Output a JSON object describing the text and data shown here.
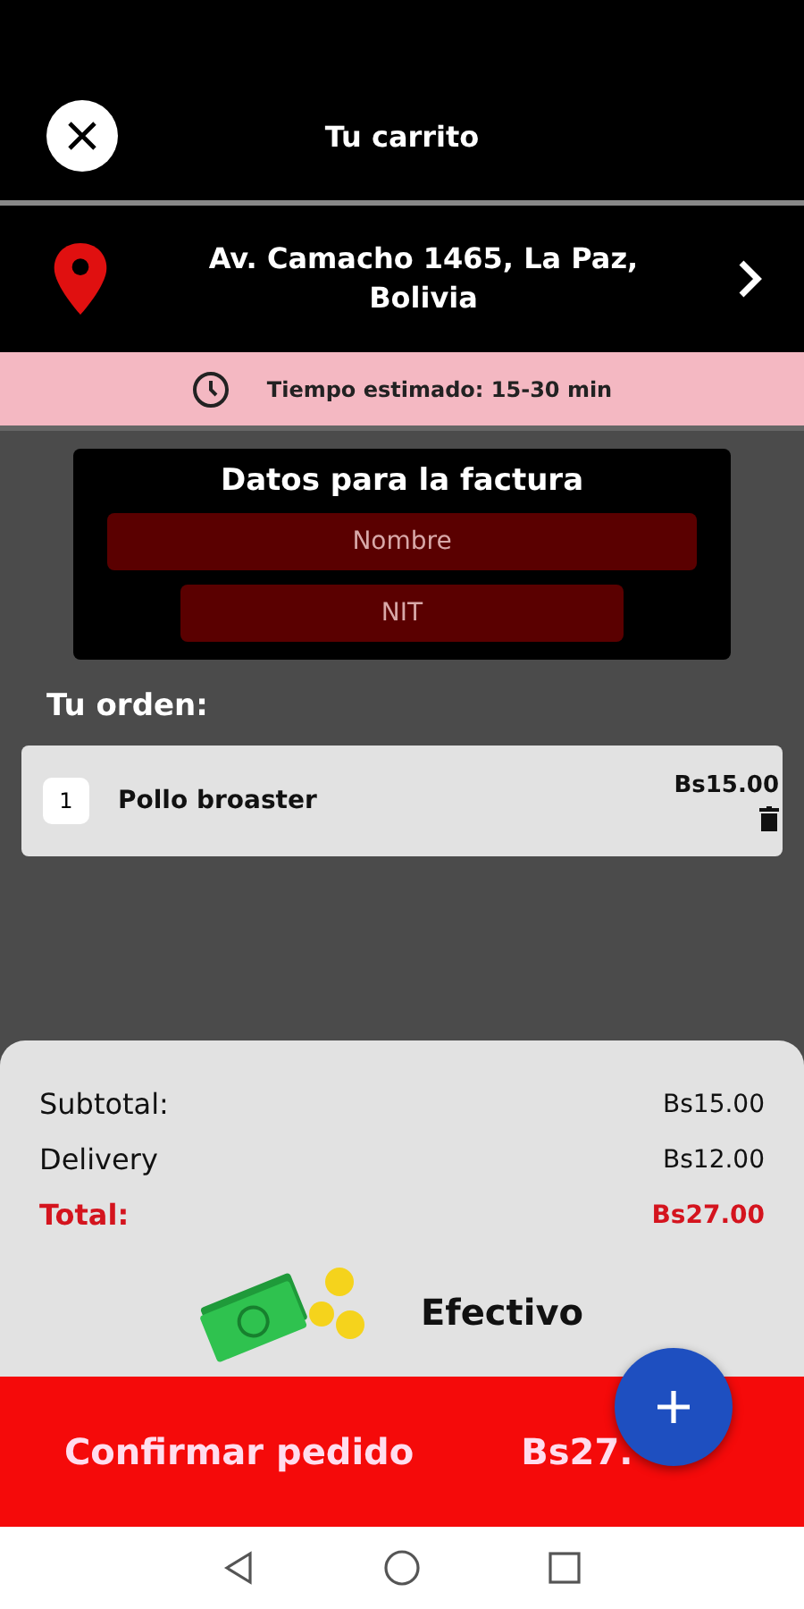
{
  "header": {
    "title": "Tu carrito"
  },
  "address": {
    "text": "Av. Camacho 1465, La Paz, Bolivia"
  },
  "eta": {
    "text": "Tiempo estimado: 15-30 min"
  },
  "invoice": {
    "title": "Datos para la factura",
    "fields": [
      {
        "placeholder": "Nombre",
        "kind": "wide"
      },
      {
        "placeholder": "NIT",
        "kind": "narrow"
      }
    ]
  },
  "order": {
    "title": "Tu orden:",
    "items": [
      {
        "quantity": "1",
        "name": "Pollo broaster",
        "price": "Bs15.00"
      }
    ]
  },
  "summary": [
    {
      "label": "Subtotal:",
      "value": "Bs15.00",
      "kind": "line"
    },
    {
      "label": "Delivery",
      "value": "Bs12.00",
      "kind": "line"
    },
    {
      "label": "Total:",
      "value": "Bs27.00",
      "kind": "total"
    }
  ],
  "payment": {
    "method": "Efectivo"
  },
  "confirm": {
    "label": "Confirmar pedido",
    "amount": "Bs27."
  }
}
